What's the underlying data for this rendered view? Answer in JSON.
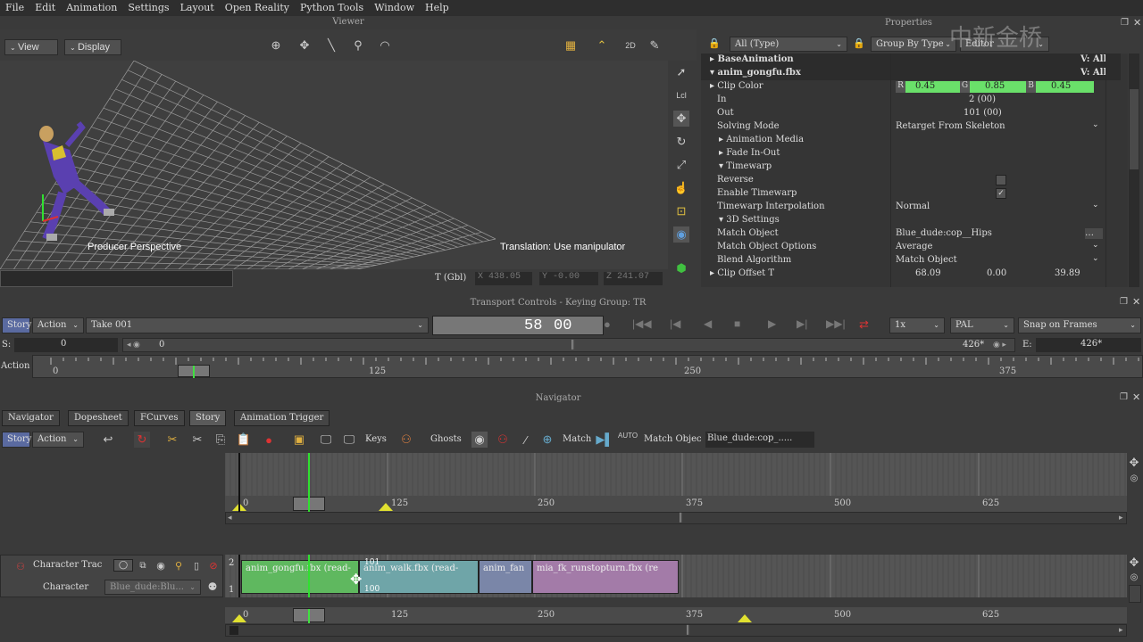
{
  "menu": [
    "File",
    "Edit",
    "Animation",
    "Settings",
    "Layout",
    "Open Reality",
    "Python Tools",
    "Window",
    "Help"
  ],
  "viewer": {
    "title": "Viewer",
    "view_btn": "View",
    "display_btn": "Display",
    "camera_label": "Producer Perspective",
    "status_label": "Translation: Use manipulator",
    "coords": {
      "prefix": "T (Gbl)",
      "x_label": "X",
      "x": "438.05",
      "y_label": "Y",
      "y": "-0.00",
      "z_label": "Z",
      "z": "241.07"
    }
  },
  "properties": {
    "title": "Properties",
    "filter": "All (Type)",
    "group_by": "Group By Type",
    "editor": "Editor",
    "v_all": "V: All",
    "items": [
      {
        "name": "BaseAnimation",
        "v": "V: All"
      },
      {
        "name": "anim_gongfu.fbx",
        "v": "V: All"
      }
    ],
    "rows": [
      {
        "label": "Clip Color",
        "value": ""
      },
      {
        "label": "In",
        "value": "2 (00)"
      },
      {
        "label": "Out",
        "value": "101 (00)"
      },
      {
        "label": "Solving Mode",
        "value": "Retarget From Skeleton"
      },
      {
        "label": "Animation Media",
        "value": ""
      },
      {
        "label": "Fade In-Out",
        "value": ""
      },
      {
        "label": "Timewarp",
        "value": ""
      },
      {
        "label": "Reverse",
        "value": ""
      },
      {
        "label": "Enable Timewarp",
        "value": ""
      },
      {
        "label": "Timewarp Interpolation",
        "value": "Normal"
      },
      {
        "label": "3D Settings",
        "value": ""
      },
      {
        "label": "Match Object",
        "value": "Blue_dude:cop__Hips"
      },
      {
        "label": "Match Object Options",
        "value": "Average"
      },
      {
        "label": "Blend Algorithm",
        "value": "Match Object"
      },
      {
        "label": "Clip Offset T",
        "value": ""
      }
    ],
    "clip_color": {
      "r_label": "R",
      "r": "0.45",
      "g_label": "G",
      "g": "0.85",
      "b_label": "B",
      "b": "0.45"
    },
    "clip_offset": {
      "x": "68.09",
      "y": "0.00",
      "z": "39.89"
    }
  },
  "transport": {
    "title": "Transport Controls  -  Keying Group: TR",
    "story_btn": "Story",
    "action_dd": "Action",
    "take": "Take 001",
    "frame": "58",
    "subframe": "00",
    "speed": "1x",
    "format": "PAL",
    "snap": "Snap on Frames",
    "s_label": "S:",
    "s_value": "0",
    "start": "0",
    "end": "426*",
    "e_label": "E:",
    "e_value": "426*",
    "action_label": "Action",
    "ticks": [
      "0",
      "125",
      "250",
      "375"
    ]
  },
  "navigator": {
    "title": "Navigator",
    "tabs": [
      "Navigator",
      "Dopesheet",
      "FCurves",
      "Story",
      "Animation Trigger"
    ],
    "toolbar": {
      "story_btn": "Story",
      "action_dd": "Action",
      "keys": "Keys",
      "ghosts": "Ghosts",
      "match": "Match",
      "auto": "AUTO",
      "match_object_label": "Match Objec",
      "match_object_value": "Blue_dude:cop_....."
    },
    "ticks": [
      "0",
      "125",
      "250",
      "375",
      "500",
      "625"
    ],
    "track": {
      "name": "Character Trac",
      "type": "Character",
      "character": "Blue_dude:Blu...",
      "layer_top": "2",
      "layer_bottom": "1"
    },
    "clips": [
      {
        "label": "anim_gongfu.fbx (read-",
        "color": "#5fb85f"
      },
      {
        "label": "anim_walk.fbx (read-",
        "color": "#6fa5a8"
      },
      {
        "label": "anim_fan",
        "color": "#7a86a8"
      },
      {
        "label": "mia_fk_runstopturn.fbx (re",
        "color": "#a37ba8"
      }
    ],
    "blend_out": "101",
    "blend_in": "100"
  },
  "watermark": "中新金桥"
}
